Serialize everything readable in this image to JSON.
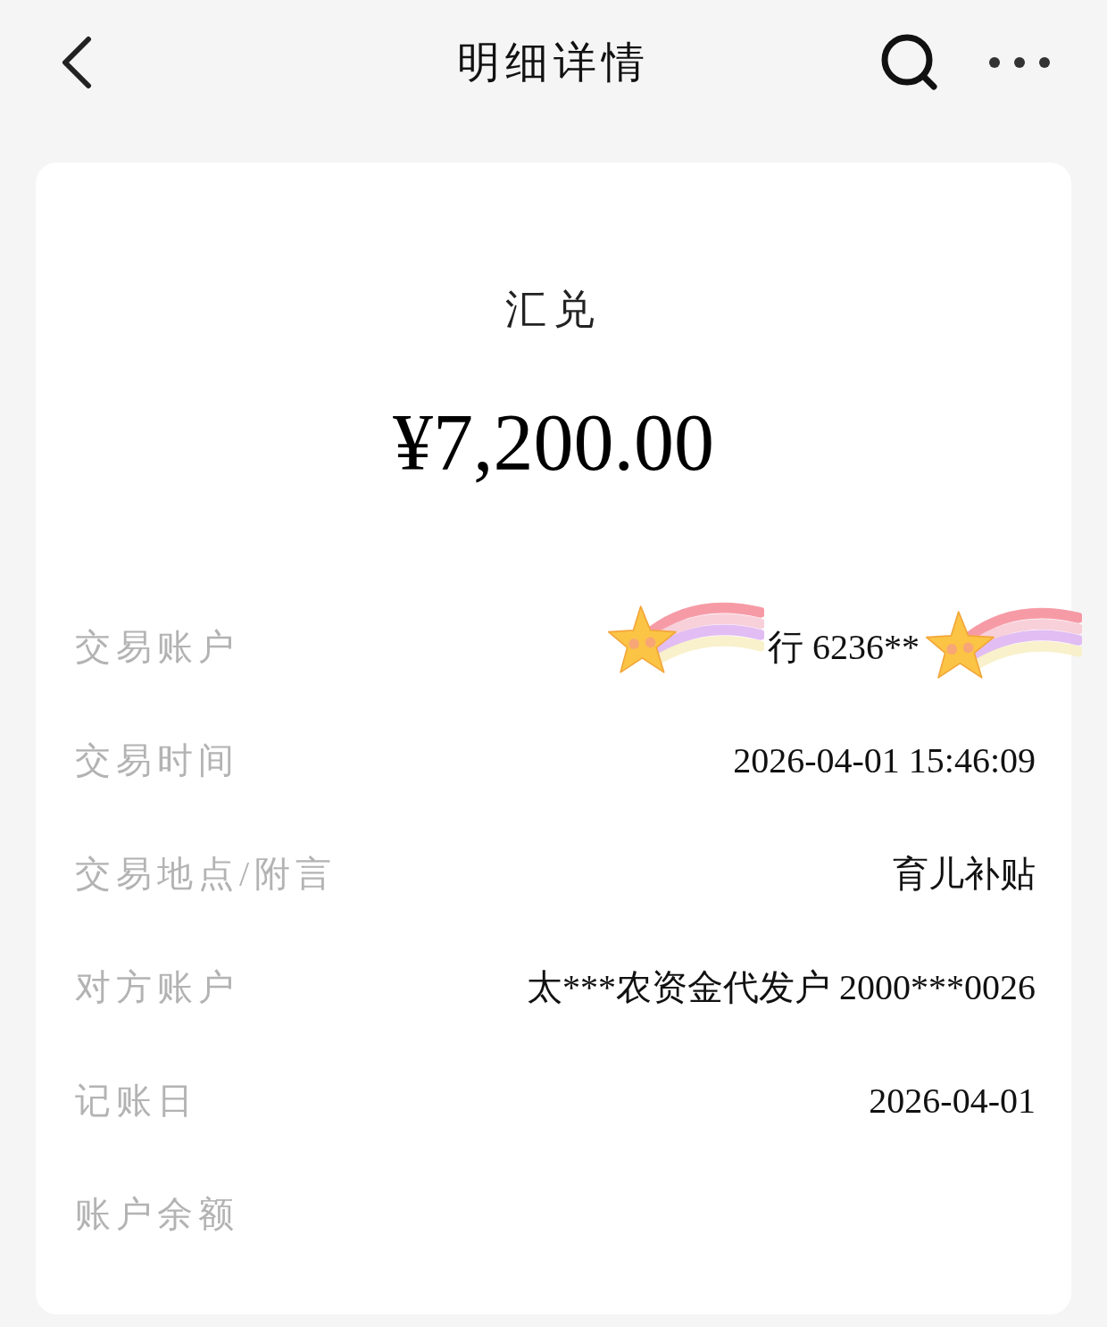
{
  "header": {
    "title": "明细详情"
  },
  "summary": {
    "type": "汇兑",
    "amount": "¥7,200.00"
  },
  "rows": [
    {
      "label": "交易账户",
      "value": "行 6236**"
    },
    {
      "label": "交易时间",
      "value": "2026-04-01 15:46:09"
    },
    {
      "label": "交易地点/附言",
      "value": "育儿补贴"
    },
    {
      "label": "对方账户",
      "value": "太***农资金代发户 2000***0026"
    },
    {
      "label": "记账日",
      "value": "2026-04-01"
    },
    {
      "label": "账户余额"
    }
  ]
}
